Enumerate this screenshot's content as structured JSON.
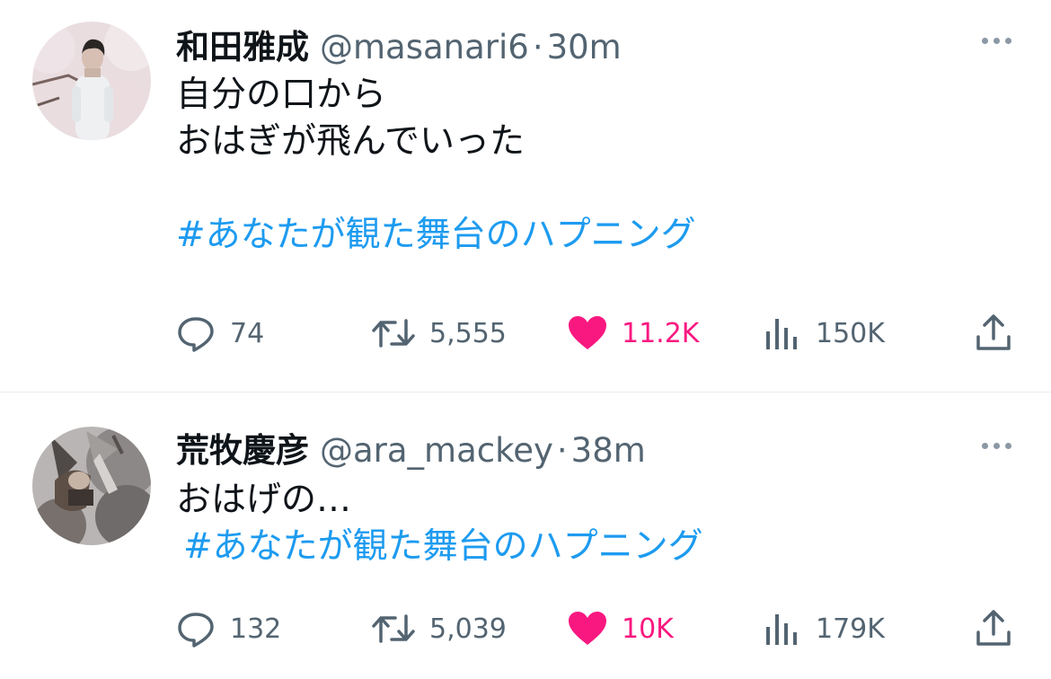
{
  "tweets": [
    {
      "author_name": "和田雅成",
      "handle": "@masanari6",
      "separator": "·",
      "time": "30m",
      "lines": [
        "自分の口から",
        "おはぎが飛んでいった"
      ],
      "hashtag": "#あなたが観た舞台のハプニング",
      "counts": {
        "replies": "74",
        "retweets": "5,555",
        "likes": "11.2K",
        "views": "150K"
      },
      "liked": true
    },
    {
      "author_name": "荒牧慶彦",
      "handle": "@ara_mackey",
      "separator": "·",
      "time": "38m",
      "lines": [
        "おはげの…"
      ],
      "hashtag": "#あなたが観た舞台のハプニング",
      "counts": {
        "replies": "132",
        "retweets": "5,039",
        "likes": "10K",
        "views": "179K"
      },
      "liked": true
    }
  ],
  "icons": [
    "reply-icon",
    "retweet-icon",
    "like-icon",
    "views-icon",
    "share-icon",
    "more-icon"
  ],
  "colors": {
    "text": "#0f1419",
    "secondary": "#536471",
    "hashtag": "#1d9bf0",
    "like": "#f91880",
    "divider": "#e6ecf0"
  }
}
